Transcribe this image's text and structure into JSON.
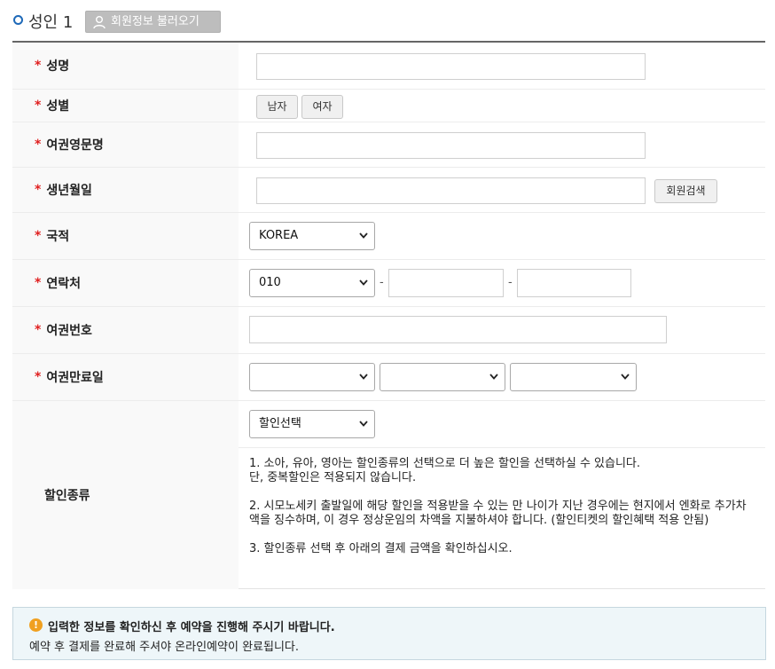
{
  "section": {
    "title": "성인 1",
    "load_button": "회원정보 불러오기"
  },
  "fields": {
    "name": {
      "label": "성명",
      "value": ""
    },
    "gender": {
      "label": "성별",
      "male": "남자",
      "female": "여자"
    },
    "passport_name": {
      "label": "여권영문명",
      "value": ""
    },
    "birth": {
      "label": "생년월일",
      "value": "",
      "search_button": "회원검색"
    },
    "nationality": {
      "label": "국적",
      "selected": "KOREA"
    },
    "phone": {
      "label": "연락처",
      "prefix": "010",
      "separator": "-",
      "middle": "",
      "last": ""
    },
    "passport_no": {
      "label": "여권번호",
      "value": ""
    },
    "passport_expiry": {
      "label": "여권만료일",
      "year": "",
      "month": "",
      "day": ""
    },
    "discount": {
      "label": "할인종류",
      "selected": "할인선택",
      "notes": [
        "1. 소아, 유아, 영아는 할인종류의 선택으로 더 높은 할인을 선택하실 수 있습니다.",
        "단, 중복할인은 적용되지 않습니다.",
        "2. 시모노세키 출발일에 해당 할인을 적용받을 수 있는 만 나이가 지난 경우에는 현지에서 엔화로 추가차액을 징수하며, 이 경우 정상운임의 차액을 지불하셔야 합니다. (할인티켓의 할인혜택 적용 안됨)",
        "3. 할인종류 선택 후 아래의 결제 금액을 확인하십시오."
      ]
    },
    "required_mark": "*"
  },
  "notice": {
    "icon": "!",
    "title": "입력한 정보를 확인하신 후 예약을 진행해 주시기 바랍니다.",
    "body": "예약 후 결제를 완료해 주셔야 온라인예약이 완료됩니다."
  },
  "colors": {
    "accent": "#1e69b8",
    "required": "#e02020",
    "warning": "#f0a020"
  }
}
